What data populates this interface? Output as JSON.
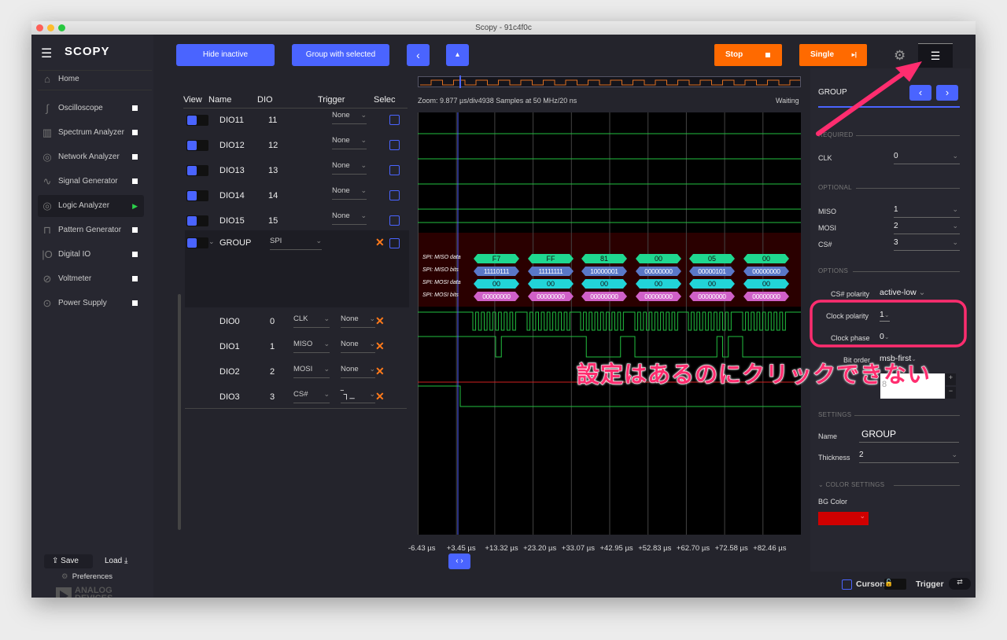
{
  "window": {
    "title": "Scopy - 91c4f0c"
  },
  "sidebar": {
    "logo": "SCOPY",
    "home": "Home",
    "items": [
      {
        "label": "Oscilloscope",
        "icon": "oscilloscope-icon",
        "status": "stopped"
      },
      {
        "label": "Spectrum Analyzer",
        "icon": "spectrum-icon",
        "status": "stopped"
      },
      {
        "label": "Network Analyzer",
        "icon": "network-icon",
        "status": "stopped"
      },
      {
        "label": "Signal Generator",
        "icon": "signal-icon",
        "status": "stopped"
      },
      {
        "label": "Logic Analyzer",
        "icon": "logic-icon",
        "status": "running"
      },
      {
        "label": "Pattern Generator",
        "icon": "pattern-icon",
        "status": "stopped"
      },
      {
        "label": "Digital IO",
        "icon": "dio-icon",
        "status": "stopped"
      },
      {
        "label": "Voltmeter",
        "icon": "voltmeter-icon",
        "status": "stopped"
      },
      {
        "label": "Power Supply",
        "icon": "power-icon",
        "status": "stopped"
      }
    ],
    "save": "Save",
    "load": "Load",
    "preferences": "Preferences",
    "brand": "ANALOG\nDEVICES"
  },
  "toolbar": {
    "hide_inactive": "Hide inactive",
    "group_selected": "Group with selected",
    "stop": "Stop",
    "single": "Single"
  },
  "channels": {
    "headers": {
      "view": "View",
      "name": "Name",
      "dio": "DIO",
      "trigger": "Trigger",
      "select": "Selec"
    },
    "rows": [
      {
        "name": "DIO11",
        "dio": "11",
        "trigger": "None"
      },
      {
        "name": "DIO12",
        "dio": "12",
        "trigger": "None"
      },
      {
        "name": "DIO13",
        "dio": "13",
        "trigger": "None"
      },
      {
        "name": "DIO14",
        "dio": "14",
        "trigger": "None"
      },
      {
        "name": "DIO15",
        "dio": "15",
        "trigger": "None"
      }
    ],
    "group": {
      "name": "GROUP",
      "decoder": "SPI",
      "members": [
        {
          "name": "DIO0",
          "dio": "0",
          "role": "CLK",
          "trigger": "None"
        },
        {
          "name": "DIO1",
          "dio": "1",
          "role": "MISO",
          "trigger": "None"
        },
        {
          "name": "DIO2",
          "dio": "2",
          "role": "MOSI",
          "trigger": "None"
        },
        {
          "name": "DIO3",
          "dio": "3",
          "role": "CS#",
          "trigger": "falling-edge"
        }
      ]
    }
  },
  "plot": {
    "info": "Zoom: 9.877 µs/div4938 Samples at 50 MHz/20 ns",
    "status": "Waiting",
    "time_labels": [
      "-6.43 µs",
      "+3.45 µs",
      "+13.32 µs",
      "+23.20 µs",
      "+33.07 µs",
      "+42.95 µs",
      "+52.83 µs",
      "+62.70 µs",
      "+72.58 µs",
      "+82.46 µs"
    ],
    "decoder_rows": [
      "SPI: MISO data",
      "SPI: MISO bits",
      "SPI: MOSI data",
      "SPI: MOSI bits"
    ],
    "miso_data": [
      "F7",
      "FF",
      "81",
      "00",
      "05",
      "00"
    ],
    "miso_bits": [
      "11110111",
      "11111111",
      "10000001",
      "00000000",
      "00000101",
      "00000000"
    ],
    "mosi_data": [
      "00",
      "00",
      "00",
      "00",
      "00",
      "00"
    ],
    "mosi_bits": [
      "00000000",
      "00000000",
      "00000000",
      "00000000",
      "00000000",
      "00000000"
    ],
    "colors": {
      "miso_data": "#1fd890",
      "miso_bits": "#5a78c8",
      "mosi_data": "#22d4d8",
      "mosi_bits": "#d060c8",
      "group_bg": "#2a0000",
      "trace_green": "#22c040",
      "trace_red": "#d02020"
    }
  },
  "panel": {
    "title": "GROUP",
    "required": "REQUIRED",
    "clk_label": "CLK",
    "clk": "0",
    "optional": "OPTIONAL",
    "miso_label": "MISO",
    "miso": "1",
    "mosi_label": "MOSI",
    "mosi": "2",
    "cs_label": "CS#",
    "cs": "3",
    "options": "OPTIONS",
    "cs_pol_label": "CS# polarity",
    "cs_pol": "active-low",
    "cpol_label": "Clock polarity",
    "cpol": "1",
    "cpha_label": "Clock phase",
    "cpha": "0",
    "bitorder_label": "Bit order",
    "bitorder": "msb-first",
    "wordsize": "8",
    "settings": "SETTINGS",
    "name_label": "Name",
    "name": "GROUP",
    "thick_label": "Thickness",
    "thick": "2",
    "color_settings": "COLOR SETTINGS",
    "bg_label": "BG Color",
    "bg_color": "#d00000"
  },
  "bottom": {
    "cursors": "Cursors",
    "trigger": "Trigger"
  },
  "annotation": {
    "text": "設定はあるのにクリックできない",
    "color": "#ff2d6f"
  }
}
